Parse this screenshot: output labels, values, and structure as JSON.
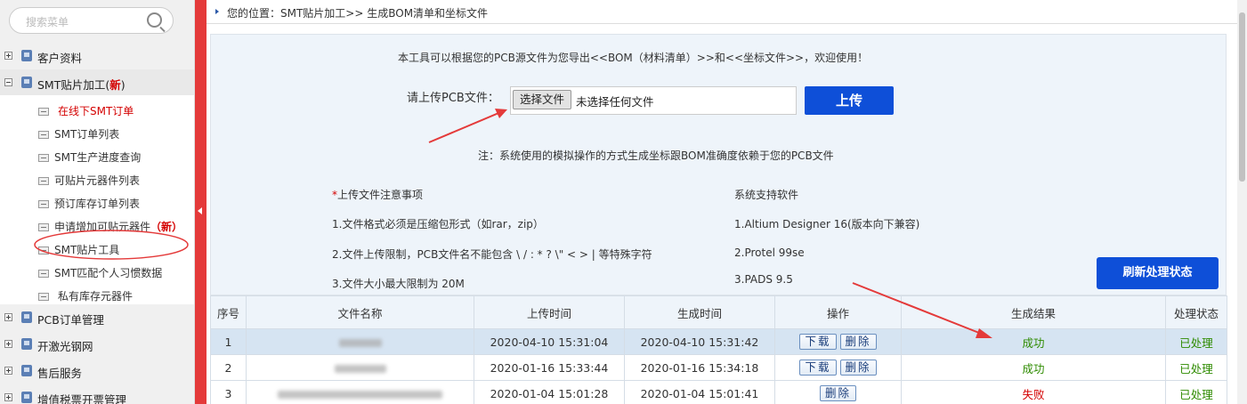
{
  "sidebar": {
    "search_placeholder": "搜索菜单",
    "groups": [
      {
        "label": "客户资料",
        "expanded": false
      },
      {
        "label": "SMT贴片加工(",
        "badge": "新",
        "suffix": ")",
        "expanded": true
      },
      {
        "label": "PCB订单管理",
        "expanded": false
      },
      {
        "label": "开激光钢网",
        "expanded": false
      },
      {
        "label": "售后服务",
        "expanded": false
      },
      {
        "label": "增值税票开票管理",
        "expanded": false
      }
    ],
    "sub_items": [
      {
        "label": "在线下SMT订单"
      },
      {
        "label": "SMT订单列表"
      },
      {
        "label": "SMT生产进度查询"
      },
      {
        "label": "可贴片元器件列表"
      },
      {
        "label": "预订库存订单列表"
      },
      {
        "label": "申请增加可贴元器件",
        "badge": "（新）"
      },
      {
        "label": "SMT贴片工具"
      },
      {
        "label": "SMT匹配个人习惯数据"
      },
      {
        "label": "私有库存元器件"
      }
    ]
  },
  "breadcrumb": "您的位置：SMT贴片加工>> 生成BOM清单和坐标文件",
  "tool": {
    "intro": "本工具可以根据您的PCB源文件为您导出<<BOM（材料清单）>>和<<坐标文件>>，欢迎使用！",
    "upload_label": "请上传PCB文件：",
    "choose_file": "选择文件",
    "no_file": "未选择任何文件",
    "upload_button": "上传",
    "note": "注：系统使用的模拟操作的方式生成坐标跟BOM准确度依赖于您的PCB文件",
    "notes_star": "*",
    "notes_title": "上传文件注意事项",
    "notes": [
      "1.文件格式必须是压缩包形式（如rar，zip）",
      "2.文件上传限制，PCB文件名不能包含 \\ / : * ? \\\" < > | 等特殊字符",
      "3.文件大小最大限制为 20M"
    ],
    "software_title": "系统支持软件",
    "software": [
      "1.Altium Designer 16(版本向下兼容)",
      "2.Protel 99se",
      "3.PADS 9.5"
    ],
    "refresh_button": "刷新处理状态"
  },
  "table": {
    "headers": [
      "序号",
      "文件名称",
      "上传时间",
      "生成时间",
      "操作",
      "生成结果",
      "处理状态"
    ],
    "download_label": "下载",
    "delete_label": "删除",
    "rows": [
      {
        "no": "1",
        "upload": "2020-04-10 15:31:04",
        "generated": "2020-04-10 15:31:42",
        "download": true,
        "result": "成功",
        "status": "已处理"
      },
      {
        "no": "2",
        "upload": "2020-01-16 15:33:44",
        "generated": "2020-01-16 15:34:18",
        "download": true,
        "result": "成功",
        "status": "已处理"
      },
      {
        "no": "3",
        "upload": "2020-01-04 15:01:28",
        "generated": "2020-01-04 15:01:41",
        "download": false,
        "result": "失败",
        "status": "已处理"
      }
    ]
  },
  "colors": {
    "accent_red": "#e43a3a",
    "primary_blue": "#0e4fd8",
    "success_green": "#2e8b00",
    "fail_red": "#d40000"
  }
}
